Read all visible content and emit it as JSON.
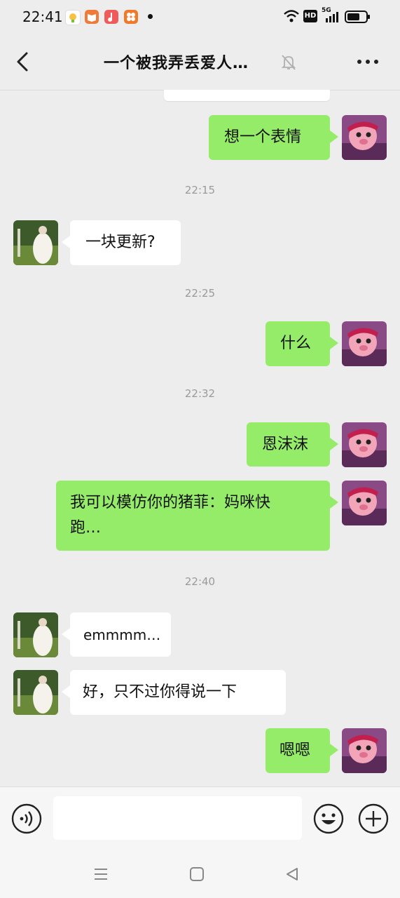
{
  "status_bar": {
    "time": "22:41",
    "battery_icon": "battery-icon",
    "signal_label": "5G",
    "hd_label": "HD"
  },
  "header": {
    "title": "一个被我弄丢爱人…",
    "back_icon": "chevron-left-icon",
    "mute_icon": "bell-off-icon",
    "more_icon": "more-dots-icon"
  },
  "messages": [
    {
      "type": "text",
      "from": "me",
      "text": "想一个表情"
    },
    {
      "type": "time",
      "text": "22:15"
    },
    {
      "type": "text",
      "from": "other",
      "text": "一块更新?"
    },
    {
      "type": "time",
      "text": "22:25"
    },
    {
      "type": "text",
      "from": "me",
      "text": "什么"
    },
    {
      "type": "time",
      "text": "22:32"
    },
    {
      "type": "text",
      "from": "me",
      "text": "恩沫沫"
    },
    {
      "type": "text",
      "from": "me",
      "text_line1": "我可以模仿你的猪菲：妈咪快",
      "text_line2": "跑…"
    },
    {
      "type": "time",
      "text": "22:40"
    },
    {
      "type": "text",
      "from": "other",
      "text": "emmmm…"
    },
    {
      "type": "text",
      "from": "other",
      "text": "好，只不过你得说一下"
    },
    {
      "type": "text",
      "from": "me",
      "text": "嗯嗯"
    }
  ],
  "input_bar": {
    "placeholder": "",
    "voice_icon": "voice-icon",
    "emoji_icon": "emoji-icon",
    "plus_icon": "plus-icon"
  },
  "colors": {
    "my_bubble": "#95ec69",
    "their_bubble": "#ffffff",
    "background": "#ededed"
  }
}
